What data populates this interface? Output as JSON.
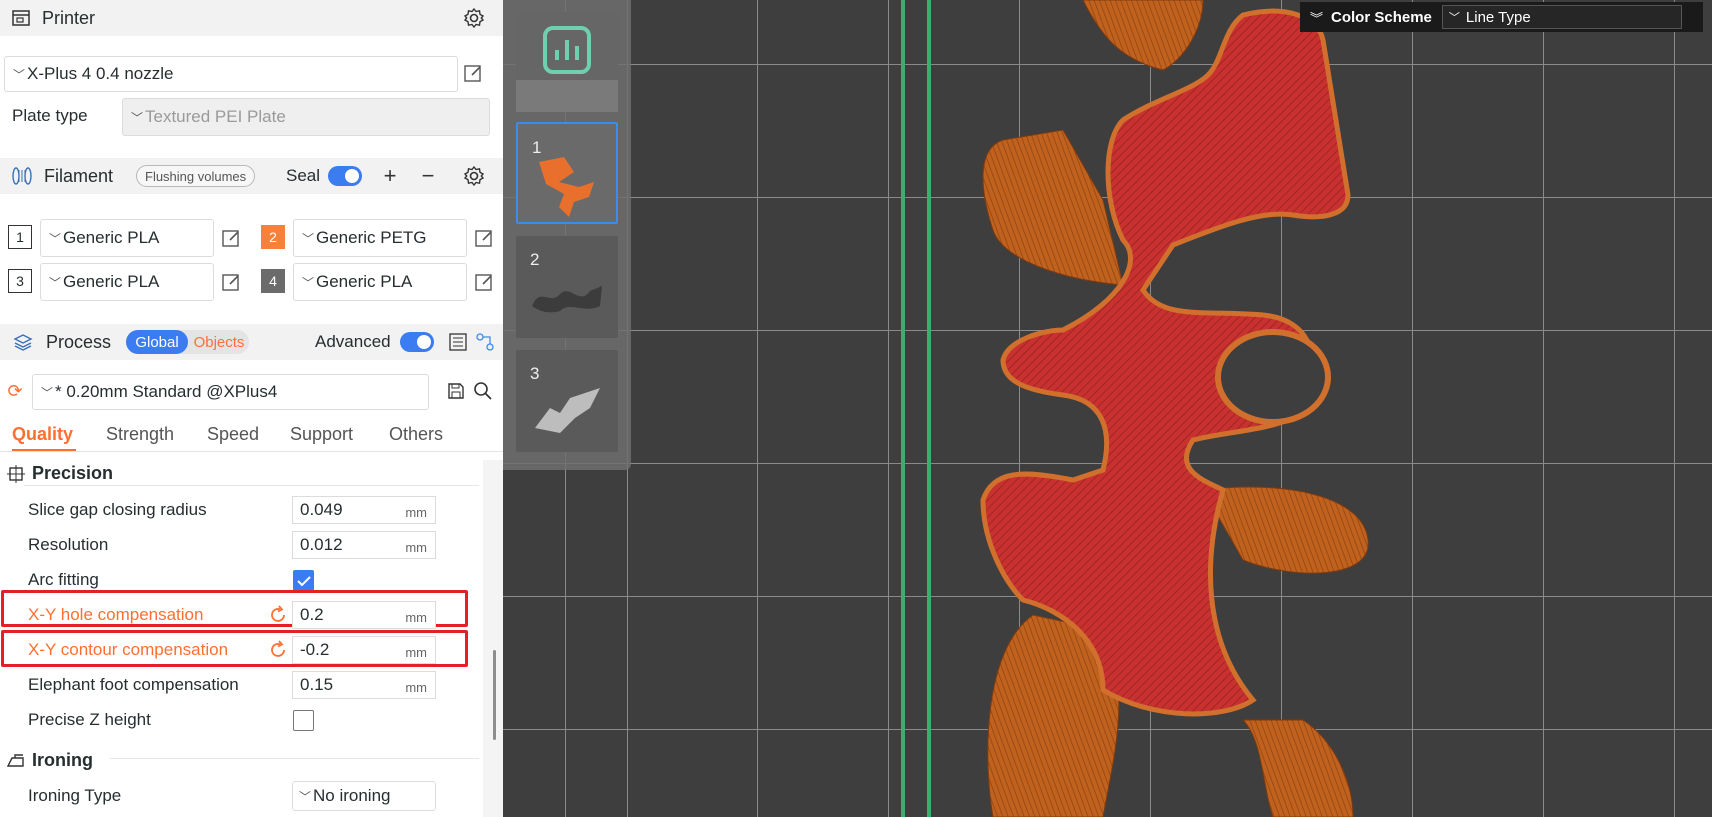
{
  "printer": {
    "section_title": "Printer",
    "model": "X-Plus 4 0.4 nozzle",
    "plate_type_label": "Plate type",
    "plate_type": "Textured PEI Plate"
  },
  "filament": {
    "section_title": "Filament",
    "flushing_label": "Flushing volumes",
    "seal_label": "Seal",
    "items": [
      {
        "index": "1",
        "name": "Generic PLA",
        "color": "#ffffff"
      },
      {
        "index": "2",
        "name": "Generic PETG",
        "color": "#f5813a"
      },
      {
        "index": "3",
        "name": "Generic PLA",
        "color": "#ffffff"
      },
      {
        "index": "4",
        "name": "Generic PLA",
        "color": "#6b6b6b"
      }
    ]
  },
  "process": {
    "section_title": "Process",
    "global_label": "Global",
    "objects_label": "Objects",
    "advanced_label": "Advanced",
    "preset": "* 0.20mm Standard @XPlus4",
    "tabs": [
      "Quality",
      "Strength",
      "Speed",
      "Support",
      "Others"
    ],
    "active_tab": "Quality"
  },
  "precision": {
    "title": "Precision",
    "slice_gap": {
      "label": "Slice gap closing radius",
      "value": "0.049",
      "unit": "mm"
    },
    "resolution": {
      "label": "Resolution",
      "value": "0.012",
      "unit": "mm"
    },
    "arc_fitting": {
      "label": "Arc fitting",
      "checked": true
    },
    "xy_hole": {
      "label": "X-Y hole compensation",
      "value": "0.2",
      "unit": "mm"
    },
    "xy_contour": {
      "label": "X-Y contour compensation",
      "value": "-0.2",
      "unit": "mm"
    },
    "elephant_foot": {
      "label": "Elephant foot compensation",
      "value": "0.15",
      "unit": "mm"
    },
    "precise_z": {
      "label": "Precise Z height",
      "checked": false
    }
  },
  "ironing": {
    "title": "Ironing",
    "type_label": "Ironing Type",
    "type_value": "No ironing"
  },
  "plates": [
    {
      "num": "1"
    },
    {
      "num": "2"
    },
    {
      "num": "3"
    }
  ],
  "color_scheme": {
    "title": "Color Scheme",
    "value": "Line Type"
  },
  "colors": {
    "accent": "#ff6f2f",
    "toggle": "#3b7cf0",
    "highlight": "#e41f26",
    "bed_edge": "#3cae6e",
    "infill": "#c8312f",
    "wall": "#c0621e"
  }
}
